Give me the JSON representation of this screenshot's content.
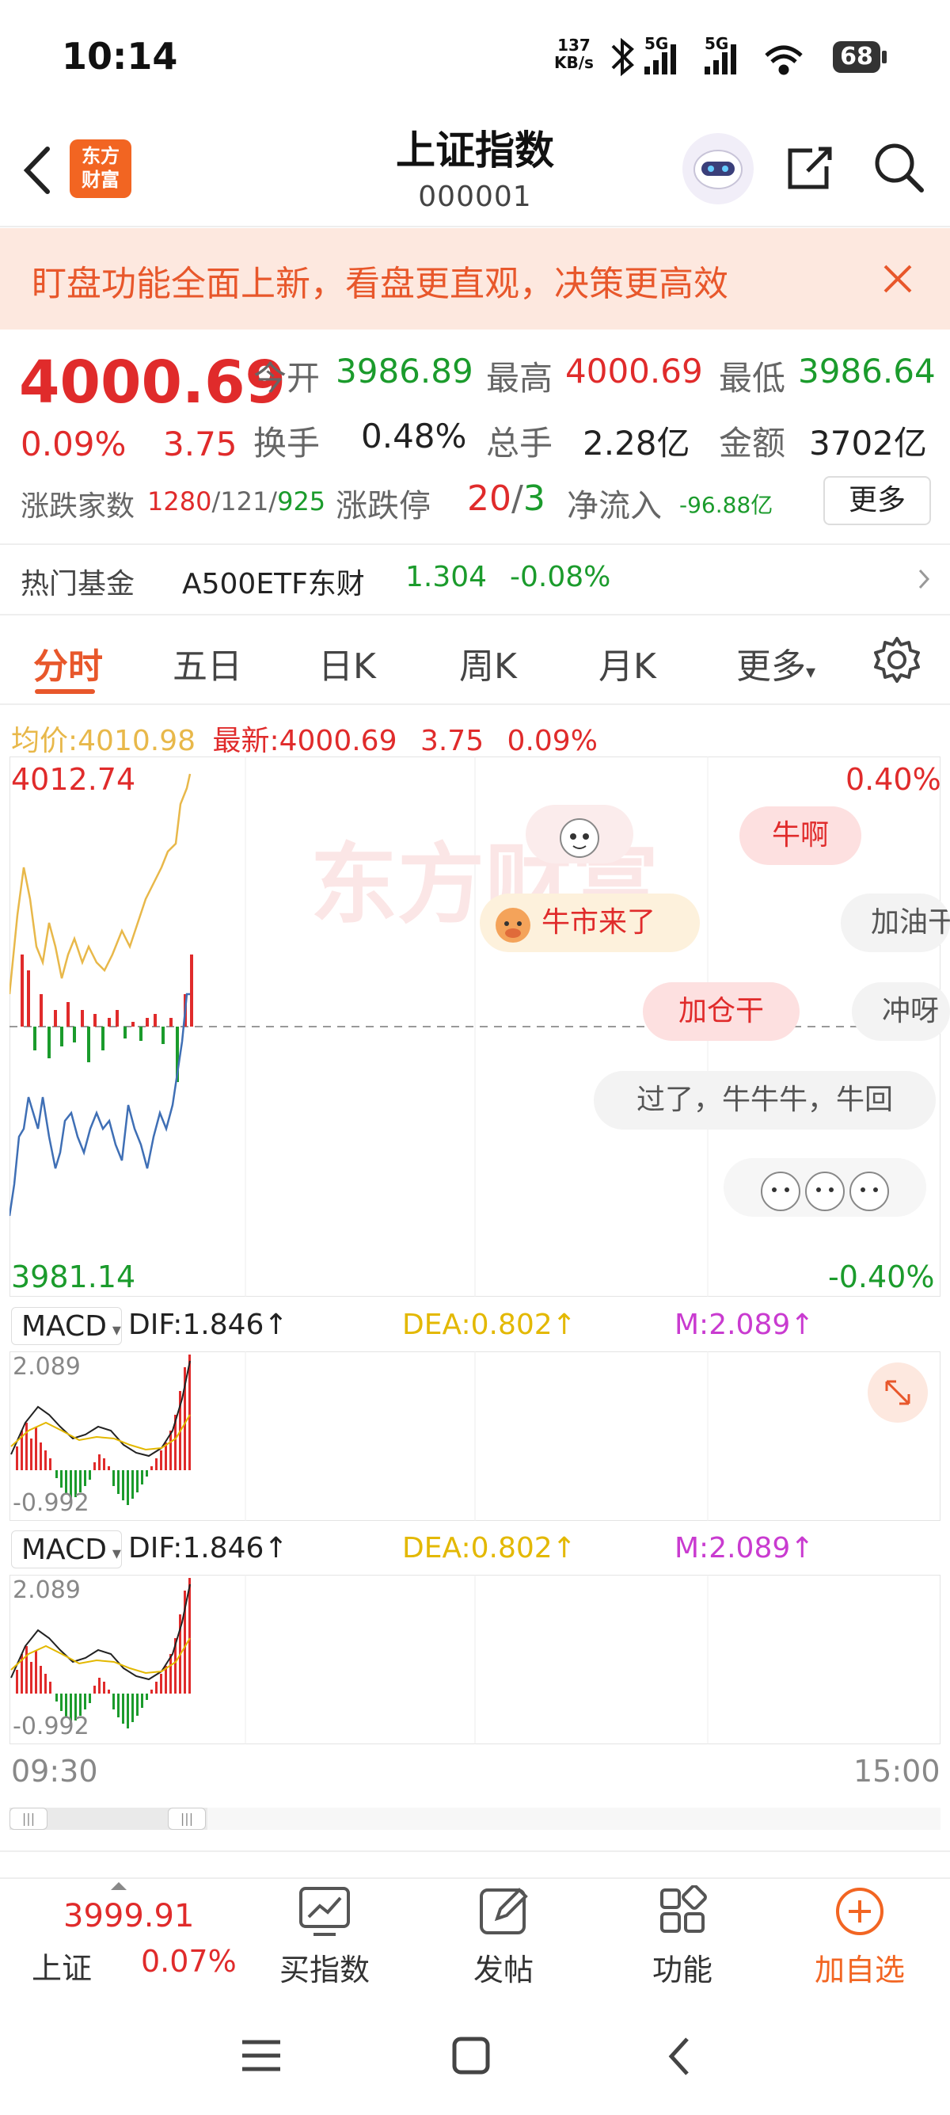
{
  "status": {
    "time": "10:14",
    "net_speed": "137",
    "net_unit": "KB/s",
    "sig1": "5G",
    "sig2": "5G",
    "battery": "68"
  },
  "header": {
    "title": "上证指数",
    "code": "000001",
    "logo_line1": "东方",
    "logo_line2": "财富"
  },
  "banner": {
    "text": "盯盘功能全面上新，看盘更直观，决策更高效"
  },
  "quote": {
    "price": "4000.69",
    "change_pct": "0.09%",
    "change": "3.75",
    "open_label": "今开",
    "open": "3986.89",
    "high_label": "最高",
    "high": "4000.69",
    "low_label": "最低",
    "low": "3986.64",
    "turnover_label": "换手",
    "turnover": "0.48%",
    "volume_label": "总手",
    "volume": "2.28亿",
    "amount_label": "金额",
    "amount": "3702亿",
    "breadth_label": "涨跌家数",
    "breadth_up": "1280",
    "breadth_flat": "121",
    "breadth_down": "925",
    "limit_label": "涨跌停",
    "limit_up": "20",
    "limit_down": "3",
    "inflow_label": "净流入",
    "inflow": "-96.88亿",
    "more": "更多"
  },
  "fund": {
    "label": "热门基金",
    "name": "A500ETF东财",
    "price": "1.304",
    "change": "-0.08%"
  },
  "tabs": [
    "分时",
    "五日",
    "日K",
    "周K",
    "月K",
    "更多"
  ],
  "info": {
    "avg_label": "均价:",
    "avg": "4010.98",
    "latest_label": "最新:",
    "latest": "4000.69",
    "chg": "3.75",
    "pct": "0.09%"
  },
  "chart": {
    "y_top": "4012.74",
    "y_bottom": "3981.14",
    "pct_top": "0.40%",
    "pct_bottom": "-0.40%",
    "x_start": "09:30",
    "x_end": "15:00",
    "watermark": "东方财富"
  },
  "comments": [
    "牛啊",
    "牛市来了",
    "加油干",
    "加仓干",
    "冲呀",
    "过了，牛牛牛，牛回"
  ],
  "macd": {
    "name": "MACD",
    "dif": "DIF:1.846↑",
    "dea": "DEA:0.802↑",
    "m": "M:2.089↑",
    "top": "2.089",
    "bottom": "-0.992"
  },
  "bottom": {
    "index_price": "3999.91",
    "index_name": "上证",
    "index_pct": "0.07%",
    "buy": "买指数",
    "post": "发帖",
    "func": "功能",
    "add": "加自选"
  },
  "colors": {
    "up": "#e02b2b",
    "down": "#1b9b2c",
    "accent": "#f26522",
    "avg_line": "#e8b84a",
    "price_line": "#3f6fb5",
    "dea": "#e3b800",
    "m": "#c93bd0"
  },
  "icons": [
    "back-icon",
    "share-icon",
    "search-icon",
    "close-icon",
    "settings-icon",
    "chevron-right-icon",
    "expand-icon",
    "chart-icon",
    "edit-icon",
    "grid-icon",
    "plus-circle-icon",
    "menu-icon",
    "home-icon",
    "nav-back-icon"
  ]
}
